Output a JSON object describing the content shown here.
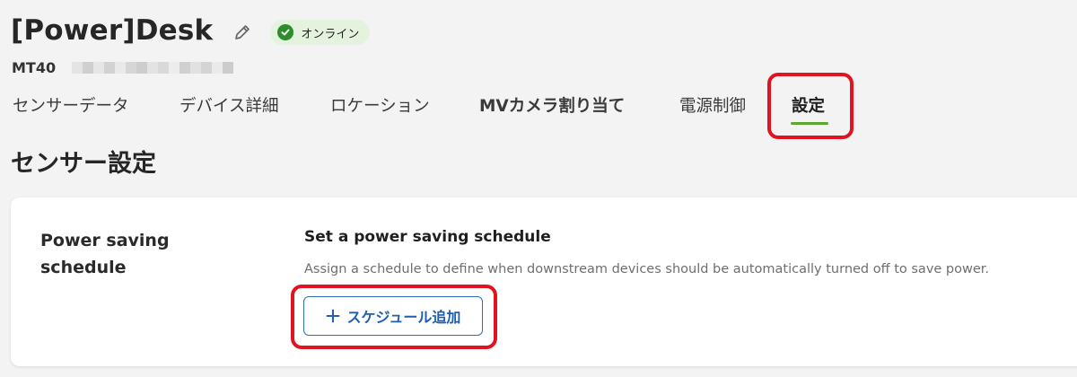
{
  "header": {
    "title": "[Power]Desk",
    "edit_icon": "pencil-icon",
    "status": {
      "label": "オンライン",
      "icon": "check-circle-icon",
      "color": "#2e8b2e"
    },
    "model": "MT40"
  },
  "tabs": [
    {
      "label": "センサーデータ",
      "active": false
    },
    {
      "label": "デバイス詳細",
      "active": false
    },
    {
      "label": "ロケーション",
      "active": false
    },
    {
      "label": "MVカメラ割り当て",
      "active": false
    },
    {
      "label": "電源制御",
      "active": false
    },
    {
      "label": "設定",
      "active": true
    }
  ],
  "section": {
    "title": "センサー設定"
  },
  "card": {
    "label": "Power saving schedule",
    "heading": "Set a power saving schedule",
    "description": "Assign a schedule to define when downstream devices should be automatically turned off to save power.",
    "button": {
      "label": "スケジュール追加",
      "icon": "plus-icon"
    }
  },
  "colors": {
    "accent_blue": "#1f5fb0",
    "active_tab_underline": "#5aa832",
    "highlight_red": "#e0131f",
    "status_bg": "#e4f3dd"
  }
}
